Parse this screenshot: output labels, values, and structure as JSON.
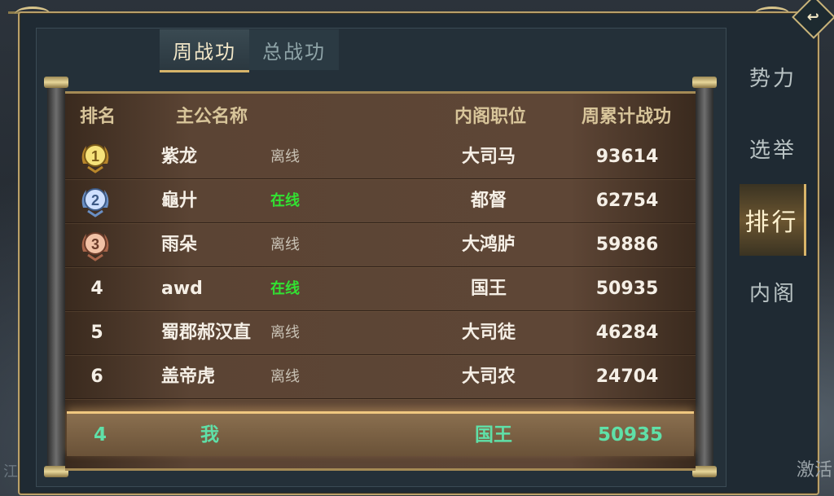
{
  "tabs": [
    {
      "label": "周战功",
      "active": true
    },
    {
      "label": "总战功",
      "active": false
    }
  ],
  "columns": {
    "rank": "排名",
    "name": "主公名称",
    "post": "内阁职位",
    "score": "周累计战功"
  },
  "rows": [
    {
      "rank": "1",
      "medal": "gold",
      "name": "紫龙",
      "status": "离线",
      "online": false,
      "post": "大司马",
      "score": "93614"
    },
    {
      "rank": "2",
      "medal": "silver",
      "name": "龜廾",
      "status": "在线",
      "online": true,
      "post": "都督",
      "score": "62754"
    },
    {
      "rank": "3",
      "medal": "bronze",
      "name": "雨朵",
      "status": "离线",
      "online": false,
      "post": "大鸿胪",
      "score": "59886"
    },
    {
      "rank": "4",
      "medal": "",
      "name": "awd",
      "status": "在线",
      "online": true,
      "post": "国王",
      "score": "50935"
    },
    {
      "rank": "5",
      "medal": "",
      "name": "蜀郡郝汉直",
      "status": "离线",
      "online": false,
      "post": "大司徒",
      "score": "46284"
    },
    {
      "rank": "6",
      "medal": "",
      "name": "盖帝虎",
      "status": "离线",
      "online": false,
      "post": "大司农",
      "score": "24704"
    }
  ],
  "my_row": {
    "rank": "4",
    "name": "我",
    "post": "国王",
    "score": "50935"
  },
  "side_tabs": [
    {
      "label": "势力",
      "active": false
    },
    {
      "label": "选举",
      "active": false
    },
    {
      "label": "排行",
      "active": true
    },
    {
      "label": "内阁",
      "active": false
    }
  ],
  "activate_label": "激活",
  "edge_label": "江",
  "back_icon": "back-arrow-icon",
  "colors": {
    "online": "#32e232",
    "offline": "#c9c2b5",
    "my_row_text": "#5fe0a8",
    "accent": "#d6b46a"
  }
}
